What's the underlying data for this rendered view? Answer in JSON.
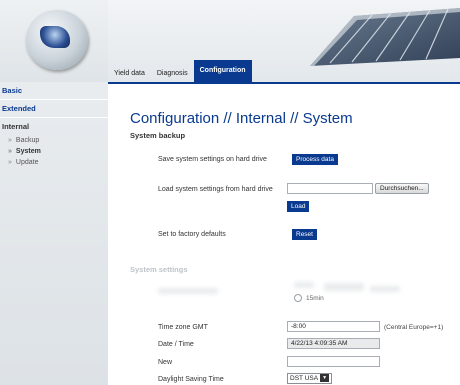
{
  "nav": {
    "tabs": [
      {
        "label": "Yield data"
      },
      {
        "label": "Diagnosis"
      },
      {
        "label": "Configuration"
      }
    ]
  },
  "sidebar": {
    "sections": [
      "Basic",
      "Extended",
      "Internal"
    ],
    "items": [
      {
        "label": "Backup"
      },
      {
        "label": "System"
      },
      {
        "label": "Update"
      }
    ]
  },
  "main": {
    "title": "Configuration // Internal // System",
    "system_backup": {
      "heading": "System backup",
      "save_label": "Save system settings on hard drive",
      "process_button": "Process data",
      "load_label": "Load system settings from hard drive",
      "file_value": "",
      "browse_button": "Durchsuchen...",
      "load_button": "Load",
      "factory_label": "Set to factory defaults",
      "reset_button": "Reset"
    },
    "system_settings": {
      "heading": "System settings",
      "interval_option": "15min",
      "timezone_label": "Time zone GMT",
      "timezone_value": "-8:00",
      "timezone_note": "(Central Europe=+1)",
      "datetime_label": "Date / Time",
      "datetime_value": "4/22/13 4:09:35 AM",
      "new_label": "New",
      "new_value": "",
      "dst_label": "Daylight Saving Time",
      "dst_value": "DST USA"
    }
  },
  "colors": {
    "brand_blue": "#0a3a8f",
    "sidebar_bg": "#e3e7ea",
    "faded_text": "#bfc4c8"
  }
}
